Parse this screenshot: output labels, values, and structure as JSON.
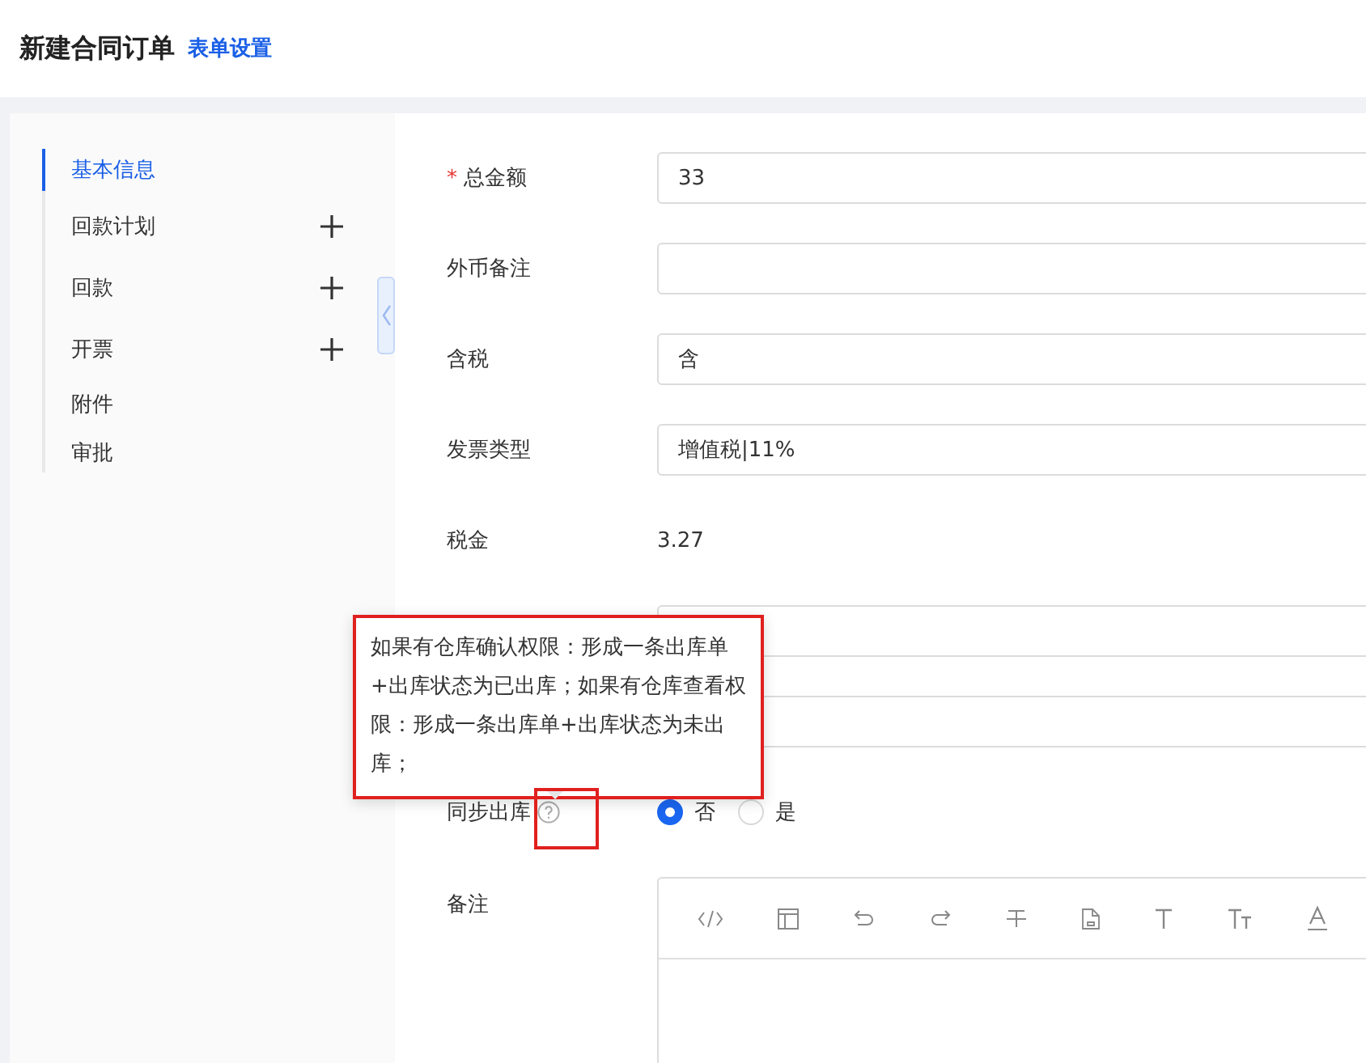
{
  "header": {
    "title": "新建合同订单",
    "link": "表单设置"
  },
  "sidebar": {
    "items": [
      {
        "label": "基本信息",
        "selected": true,
        "addable": false
      },
      {
        "label": "回款计划",
        "selected": false,
        "addable": true
      },
      {
        "label": "回款",
        "selected": false,
        "addable": true
      },
      {
        "label": "开票",
        "selected": false,
        "addable": true
      },
      {
        "label": "附件",
        "selected": false,
        "addable": false
      },
      {
        "label": "审批",
        "selected": false,
        "addable": false
      }
    ]
  },
  "form": {
    "rows": [
      {
        "kind": "input",
        "label": "总金额",
        "mark": "*",
        "value": "33"
      },
      {
        "kind": "input",
        "label": "外币备注"
      },
      {
        "kind": "input",
        "label": "含税",
        "value": "含"
      },
      {
        "kind": "input",
        "label": "发票类型",
        "value": "增值税|11%"
      },
      {
        "kind": "text",
        "label": "税金",
        "value": "3.27"
      },
      {
        "kind": "input"
      },
      {
        "kind": "input"
      },
      {
        "kind": "radio",
        "label": "同步出库",
        "help": true,
        "options": [
          {
            "label": "否",
            "selected": true
          },
          {
            "label": "是",
            "selected": false
          }
        ]
      },
      {
        "kind": "editor",
        "label": "备注"
      }
    ]
  },
  "tooltip": {
    "text": "如果有仓库确认权限：形成一条出库单+出库状态为已出库；如果有仓库查看权限：形成一条出库单+出库状态为未出库；"
  }
}
